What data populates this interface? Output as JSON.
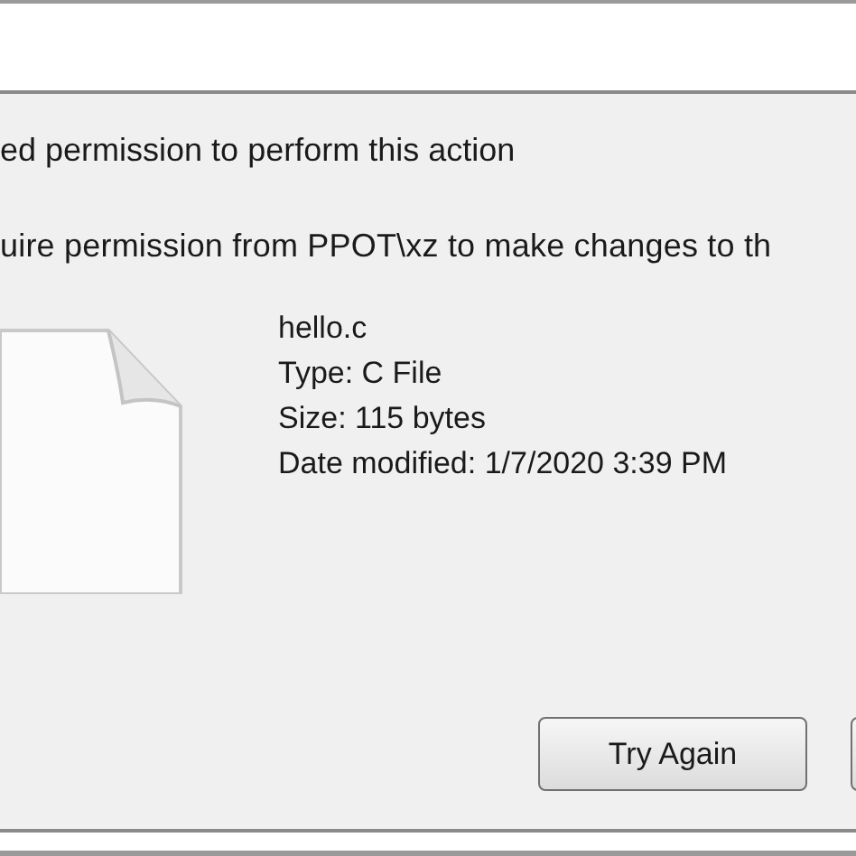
{
  "heading": "ed permission to perform this action",
  "message": "uire permission from PPOT\\xz to make changes to th",
  "file": {
    "name": "hello.c",
    "type": "Type: C File",
    "size": "Size: 115 bytes",
    "date_modified": "Date modified: 1/7/2020 3:39 PM"
  },
  "buttons": [
    {
      "label": "Try Again"
    }
  ]
}
